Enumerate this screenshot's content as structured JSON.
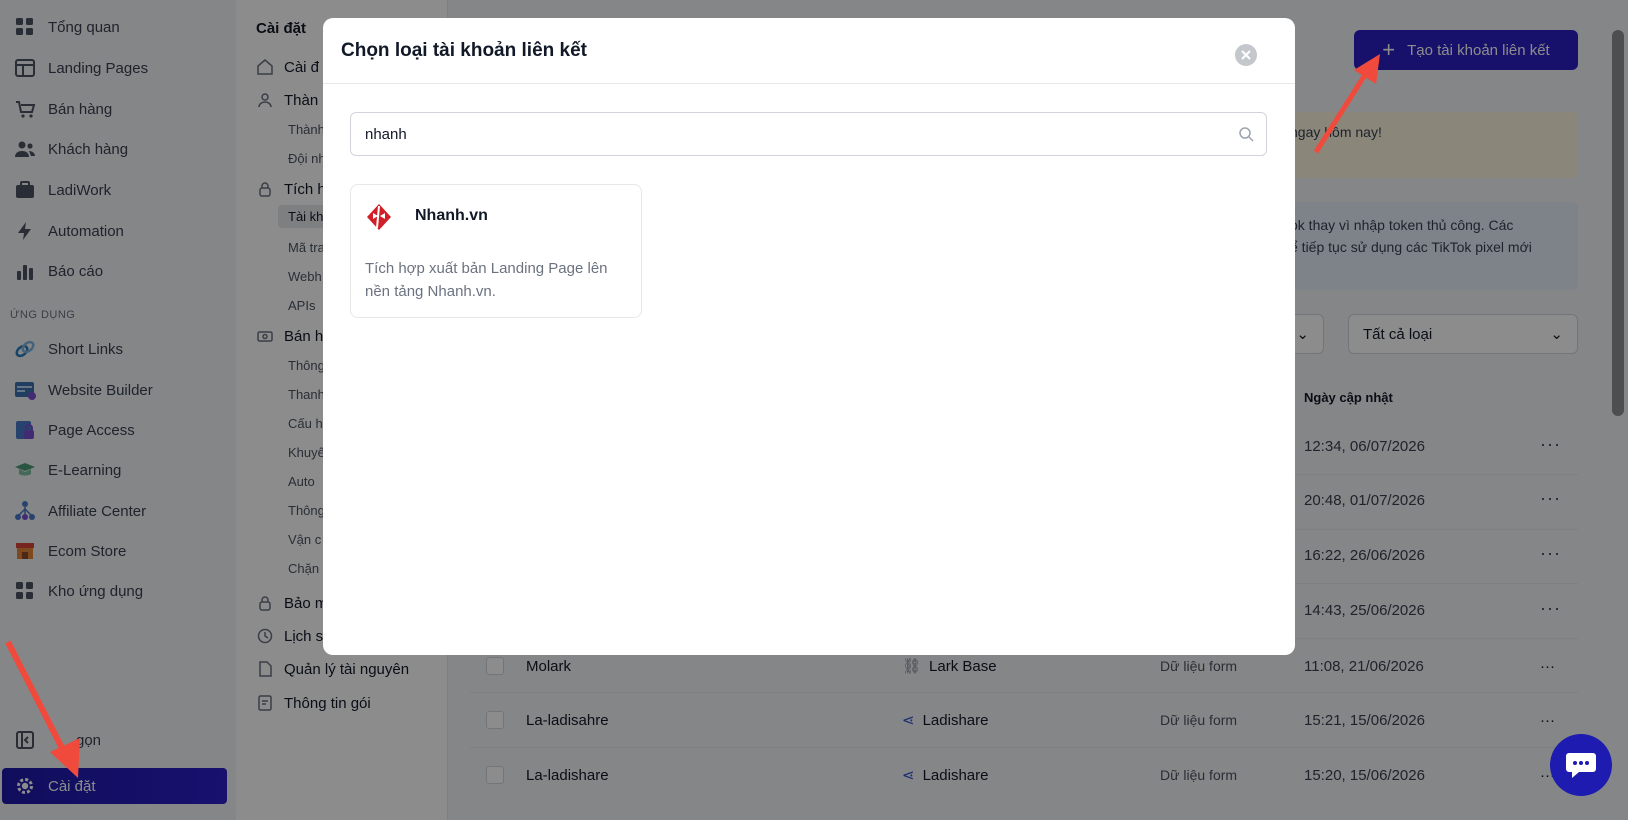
{
  "sidebar": {
    "items": [
      {
        "label": "Tổng quan",
        "icon": "grid-icon"
      },
      {
        "label": "Landing Pages",
        "icon": "layout-icon"
      },
      {
        "label": "Bán hàng",
        "icon": "cart-icon"
      },
      {
        "label": "Khách hàng",
        "icon": "users-icon"
      },
      {
        "label": "LadiWork",
        "icon": "briefcase-icon"
      },
      {
        "label": "Automation",
        "icon": "lightning-icon"
      },
      {
        "label": "Báo cáo",
        "icon": "bar-chart-icon"
      }
    ],
    "apps_section": "ỨNG DỤNG",
    "apps": [
      {
        "label": "Short Links",
        "icon": "link-icon"
      },
      {
        "label": "Website Builder",
        "icon": "website-icon"
      },
      {
        "label": "Page Access",
        "icon": "lock-page-icon"
      },
      {
        "label": "E-Learning",
        "icon": "graduation-icon"
      },
      {
        "label": "Affiliate Center",
        "icon": "network-icon"
      },
      {
        "label": "Ecom Store",
        "icon": "store-icon"
      },
      {
        "label": "Kho ứng dụng",
        "icon": "apps-icon"
      }
    ],
    "collapse_label": "gọn",
    "settings_label": "Cài đặt"
  },
  "subnav": {
    "title": "Cài đặt",
    "groups": [
      {
        "label": "Cài đ",
        "icon": "home-icon"
      },
      {
        "label": "Thàn",
        "icon": "team-icon"
      },
      {
        "label": "Tích h",
        "icon": "lock-icon"
      },
      {
        "label": "Bán h",
        "icon": "money-icon"
      },
      {
        "label": "Bảo m",
        "icon": "shield-lock-icon"
      },
      {
        "label": "Lịch s",
        "icon": "history-icon"
      },
      {
        "label": "Quản lý tài nguyên",
        "icon": "file-icon"
      },
      {
        "label": "Thông tin gói",
        "icon": "edit-note-icon"
      }
    ],
    "items_team": [
      "Thành",
      "Đội nh"
    ],
    "items_integration": [
      "Tài kh",
      "Mã tra",
      "Webh",
      "APIs"
    ],
    "items_sales": [
      "Thông",
      "Thanh",
      "Cấu h",
      "Khuyế",
      "Auto",
      "Thông",
      "Vận c",
      "Chặn"
    ]
  },
  "main": {
    "create_button": "Tạo tài khoản liên kết",
    "banner1_text": "ngay hôm nay!",
    "banner2_line1": "ok thay vì nhập token thủ công. Các",
    "banner2_line2": "ể tiếp tục sử dụng các TikTok pixel mới",
    "filter_type": "Tất cả loại",
    "col_updated": "Ngày cập nhật",
    "dates": [
      "12:34, 06/07/2026",
      "20:48, 01/07/2026",
      "16:22, 26/06/2026",
      "14:43, 25/06/2026"
    ],
    "rows": [
      {
        "name": "Molark",
        "platform": "Lark Base",
        "type": "Dữ liệu form",
        "date": "11:08, 21/06/2026"
      },
      {
        "name": "La-ladisahre",
        "platform": "Ladishare",
        "type": "Dữ liệu form",
        "date": "15:21, 15/06/2026"
      },
      {
        "name": "La-ladishare",
        "platform": "Ladishare",
        "type": "Dữ liệu form",
        "date": "15:20, 15/06/2026"
      }
    ],
    "more": "···"
  },
  "modal": {
    "title": "Chọn loại tài khoản liên kết",
    "search_value": "nhanh",
    "card_title": "Nhanh.vn",
    "card_desc": "Tích hợp xuất bản Landing Page lên nền tảng Nhanh.vn."
  },
  "colors": {
    "primary": "#2a1fc4",
    "nhanh_red": "#d11f2a"
  }
}
